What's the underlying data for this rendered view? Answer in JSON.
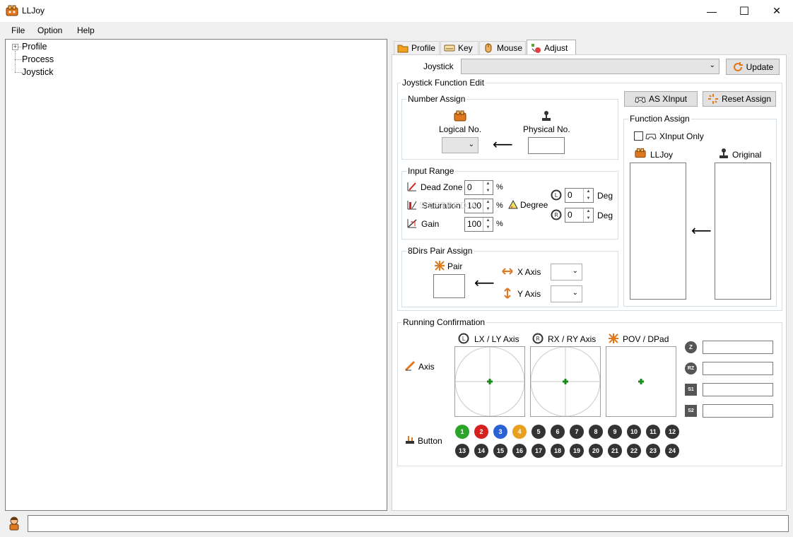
{
  "window": {
    "title": "LLJoy",
    "minimize": "—",
    "maximize": "☐",
    "close": "✕"
  },
  "menu": [
    "File",
    "Option",
    "Help"
  ],
  "tree": {
    "expander": "⊞",
    "items": [
      "Profile",
      "Process",
      "Joystick"
    ]
  },
  "tabs": [
    {
      "label": "Profile",
      "icon": "folder-icon"
    },
    {
      "label": "Key",
      "icon": "keyboard-icon"
    },
    {
      "label": "Mouse",
      "icon": "mouse-icon"
    },
    {
      "label": "Adjust",
      "icon": "adjust-icon"
    }
  ],
  "joystick": {
    "label": "Joystick",
    "value": "",
    "update_label": "Update"
  },
  "jfe": {
    "title": "Joystick Function Edit",
    "as_xinput": "AS XInput",
    "reset_assign": "Reset Assign",
    "number_assign": {
      "title": "Number Assign",
      "logical": "Logical No.",
      "physical": "Physical No.",
      "arrow": "⟵"
    },
    "input_range": {
      "title": "Input Range",
      "dead_zone": "Dead Zone",
      "dead_zone_value": "0",
      "saturation": "Saturation",
      "saturation_value": "100",
      "gain": "Gain",
      "gain_value": "100",
      "percent": "%",
      "degree": "Degree",
      "deg1_value": "0",
      "deg2_value": "0",
      "deg": "Deg"
    },
    "pair": {
      "title": "8Dirs Pair Assign",
      "pair": "Pair",
      "x_axis": "X Axis",
      "y_axis": "Y Axis",
      "arrow": "⟵"
    },
    "function_assign": {
      "title": "Function Assign",
      "xinput_only": "XInput Only",
      "lljoy": "LLJoy",
      "original": "Original",
      "arrow": "⟵"
    }
  },
  "running": {
    "title": "Running Confirmation",
    "axis": "Axis",
    "button": "Button",
    "lxly": "LX / LY Axis",
    "rxry": "RX / RY Axis",
    "pov": "POV / DPad",
    "axis_icons": [
      "Z",
      "RZ",
      "S1",
      "S2"
    ],
    "buttons_row1": [
      "1",
      "2",
      "3",
      "4",
      "5",
      "6",
      "7",
      "8",
      "9",
      "10",
      "11",
      "12"
    ],
    "buttons_row2": [
      "13",
      "14",
      "15",
      "16",
      "17",
      "18",
      "19",
      "20",
      "21",
      "22",
      "23",
      "24"
    ],
    "colors": {
      "b1": "#2aa52a",
      "b2": "#d62020",
      "b3": "#2a62d6",
      "b4": "#e8a020",
      "inactive": "#333333",
      "cross": "#1a8a1a"
    }
  },
  "statusbar": {
    "text": ""
  },
  "watermark": "SOFTPEDIA"
}
